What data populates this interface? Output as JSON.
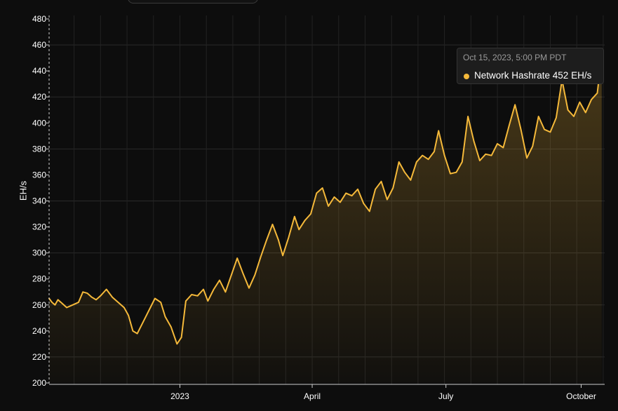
{
  "chart_data": {
    "type": "area",
    "title": "",
    "xlabel": "",
    "ylabel": "EH/s",
    "ylim": [
      200,
      480
    ],
    "yticks": [
      200,
      220,
      240,
      260,
      280,
      300,
      320,
      340,
      360,
      380,
      400,
      420,
      440,
      460,
      480
    ],
    "xlim": [
      "2022-10-04",
      "2023-10-17"
    ],
    "xticks": [
      {
        "date": "2023-01-01",
        "label": "2023"
      },
      {
        "date": "2023-04-01",
        "label": "April"
      },
      {
        "date": "2023-07-01",
        "label": "July"
      },
      {
        "date": "2023-10-01",
        "label": "October"
      }
    ],
    "grid": true,
    "series": [
      {
        "name": "Network Hashrate",
        "color": "#f5b93a",
        "points": [
          [
            "2022-10-04",
            265
          ],
          [
            "2022-10-06",
            262
          ],
          [
            "2022-10-08",
            260
          ],
          [
            "2022-10-10",
            264
          ],
          [
            "2022-10-13",
            261
          ],
          [
            "2022-10-16",
            258
          ],
          [
            "2022-10-20",
            260
          ],
          [
            "2022-10-24",
            262
          ],
          [
            "2022-10-27",
            270
          ],
          [
            "2022-10-30",
            269
          ],
          [
            "2022-11-02",
            266
          ],
          [
            "2022-11-05",
            264
          ],
          [
            "2022-11-08",
            267
          ],
          [
            "2022-11-12",
            272
          ],
          [
            "2022-11-16",
            266
          ],
          [
            "2022-11-20",
            262
          ],
          [
            "2022-11-24",
            258
          ],
          [
            "2022-11-27",
            252
          ],
          [
            "2022-11-30",
            240
          ],
          [
            "2022-12-03",
            238
          ],
          [
            "2022-12-07",
            247
          ],
          [
            "2022-12-11",
            256
          ],
          [
            "2022-12-15",
            265
          ],
          [
            "2022-12-19",
            262
          ],
          [
            "2022-12-22",
            251
          ],
          [
            "2022-12-26",
            243
          ],
          [
            "2022-12-30",
            230
          ],
          [
            "2023-01-02",
            235
          ],
          [
            "2023-01-05",
            263
          ],
          [
            "2023-01-09",
            268
          ],
          [
            "2023-01-13",
            267
          ],
          [
            "2023-01-17",
            272
          ],
          [
            "2023-01-20",
            263
          ],
          [
            "2023-01-24",
            272
          ],
          [
            "2023-01-28",
            279
          ],
          [
            "2023-02-01",
            270
          ],
          [
            "2023-02-05",
            283
          ],
          [
            "2023-02-09",
            296
          ],
          [
            "2023-02-13",
            284
          ],
          [
            "2023-02-17",
            273
          ],
          [
            "2023-02-21",
            283
          ],
          [
            "2023-02-25",
            297
          ],
          [
            "2023-03-01",
            310
          ],
          [
            "2023-03-05",
            322
          ],
          [
            "2023-03-09",
            310
          ],
          [
            "2023-03-12",
            298
          ],
          [
            "2023-03-16",
            312
          ],
          [
            "2023-03-20",
            328
          ],
          [
            "2023-03-23",
            318
          ],
          [
            "2023-03-27",
            325
          ],
          [
            "2023-03-31",
            330
          ],
          [
            "2023-04-04",
            346
          ],
          [
            "2023-04-08",
            350
          ],
          [
            "2023-04-12",
            336
          ],
          [
            "2023-04-16",
            343
          ],
          [
            "2023-04-20",
            339
          ],
          [
            "2023-04-24",
            346
          ],
          [
            "2023-04-28",
            344
          ],
          [
            "2023-05-02",
            349
          ],
          [
            "2023-05-06",
            338
          ],
          [
            "2023-05-10",
            332
          ],
          [
            "2023-05-14",
            349
          ],
          [
            "2023-05-18",
            355
          ],
          [
            "2023-05-22",
            341
          ],
          [
            "2023-05-26",
            350
          ],
          [
            "2023-05-30",
            370
          ],
          [
            "2023-06-03",
            362
          ],
          [
            "2023-06-07",
            356
          ],
          [
            "2023-06-11",
            370
          ],
          [
            "2023-06-15",
            375
          ],
          [
            "2023-06-19",
            372
          ],
          [
            "2023-06-23",
            378
          ],
          [
            "2023-06-26",
            394
          ],
          [
            "2023-06-30",
            375
          ],
          [
            "2023-07-04",
            361
          ],
          [
            "2023-07-08",
            362
          ],
          [
            "2023-07-12",
            370
          ],
          [
            "2023-07-16",
            405
          ],
          [
            "2023-07-20",
            386
          ],
          [
            "2023-07-24",
            371
          ],
          [
            "2023-07-28",
            376
          ],
          [
            "2023-08-01",
            375
          ],
          [
            "2023-08-05",
            384
          ],
          [
            "2023-08-09",
            381
          ],
          [
            "2023-08-13",
            398
          ],
          [
            "2023-08-17",
            414
          ],
          [
            "2023-08-21",
            395
          ],
          [
            "2023-08-25",
            373
          ],
          [
            "2023-08-29",
            382
          ],
          [
            "2023-09-02",
            405
          ],
          [
            "2023-09-06",
            395
          ],
          [
            "2023-09-10",
            393
          ],
          [
            "2023-09-14",
            404
          ],
          [
            "2023-09-18",
            433
          ],
          [
            "2023-09-22",
            410
          ],
          [
            "2023-09-26",
            405
          ],
          [
            "2023-09-30",
            416
          ],
          [
            "2023-10-04",
            408
          ],
          [
            "2023-10-08",
            418
          ],
          [
            "2023-10-12",
            423
          ],
          [
            "2023-10-15",
            452
          ]
        ]
      }
    ],
    "tooltip": {
      "date": "Oct 15, 2023, 5:00 PM PDT",
      "label": "Network Hashrate 452 EH/s",
      "date_value": "2023-10-15",
      "value": 452
    }
  }
}
